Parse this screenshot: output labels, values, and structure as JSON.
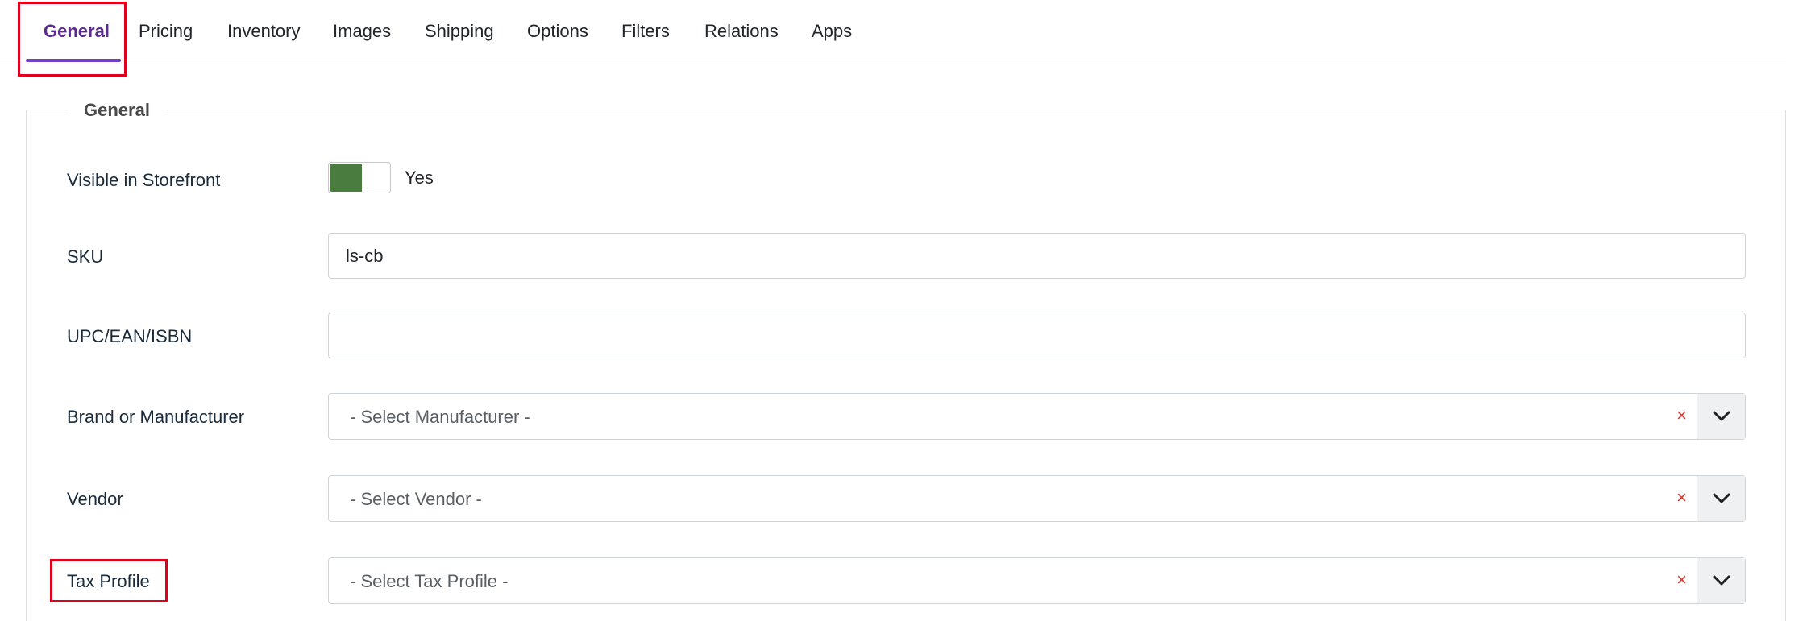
{
  "tabs": [
    {
      "label": "General",
      "active": true
    },
    {
      "label": "Pricing"
    },
    {
      "label": "Inventory"
    },
    {
      "label": "Images"
    },
    {
      "label": "Shipping"
    },
    {
      "label": "Options"
    },
    {
      "label": "Filters"
    },
    {
      "label": "Relations"
    },
    {
      "label": "Apps"
    }
  ],
  "section": {
    "legend": "General"
  },
  "fields": {
    "visible": {
      "label": "Visible in Storefront",
      "value": "Yes",
      "checked": true
    },
    "sku": {
      "label": "SKU",
      "value": "ls-cb"
    },
    "upc": {
      "label": "UPC/EAN/ISBN",
      "value": ""
    },
    "brand": {
      "label": "Brand or Manufacturer",
      "placeholder": "- Select Manufacturer -",
      "clear": "×"
    },
    "vendor": {
      "label": "Vendor",
      "placeholder": "- Select Vendor -",
      "clear": "×"
    },
    "tax": {
      "label": "Tax Profile",
      "placeholder": "- Select Tax Profile -",
      "clear": "×"
    }
  },
  "colors": {
    "accent": "#6f42c1",
    "toggle_on": "#4a7c3f",
    "highlight": "#e0001b",
    "clear": "#d9332b"
  },
  "icons": {
    "select_arrow": "chevron-down-icon"
  }
}
